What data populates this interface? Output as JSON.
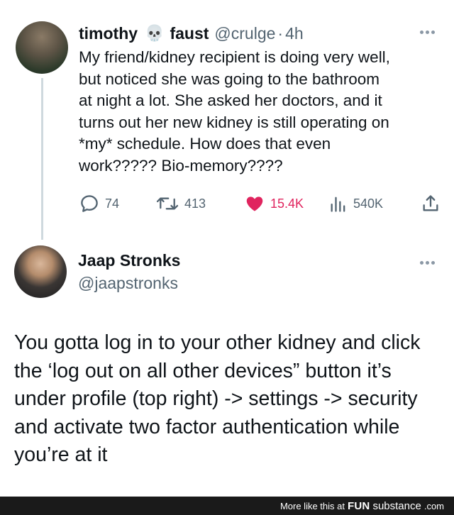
{
  "tweet1": {
    "display_name": "timothy",
    "name_emoji": "💀",
    "display_name_2": "faust",
    "handle": "@crulge",
    "separator": "·",
    "time": "4h",
    "text": "My friend/kidney recipient is doing very well,\nbut noticed she was going to the bathroom\nat night a lot. She asked her doctors, and it\nturns out her new kidney is still operating on\n*my* schedule. How does that even\nwork????? Bio-memory????",
    "actions": {
      "replies": "74",
      "retweets": "413",
      "likes": "15.4K",
      "views": "540K"
    },
    "icons": [
      "reply-icon",
      "retweet-icon",
      "heart-icon",
      "views-icon",
      "share-icon",
      "more-icon"
    ],
    "like_color": "#e0245e"
  },
  "tweet2": {
    "display_name": "Jaap Stronks",
    "handle": "@jaapstronks",
    "text": "You gotta log in to your other kidney and click\nthe ‘log out on all other devices” button it’s\nunder profile (top right) -> settings -> security\nand activate two factor authentication while\nyou’re at it"
  },
  "footer": {
    "text": "More like this at",
    "brand_bold": "FUN",
    "brand_thin": "substance",
    "brand_tld": ".com"
  }
}
